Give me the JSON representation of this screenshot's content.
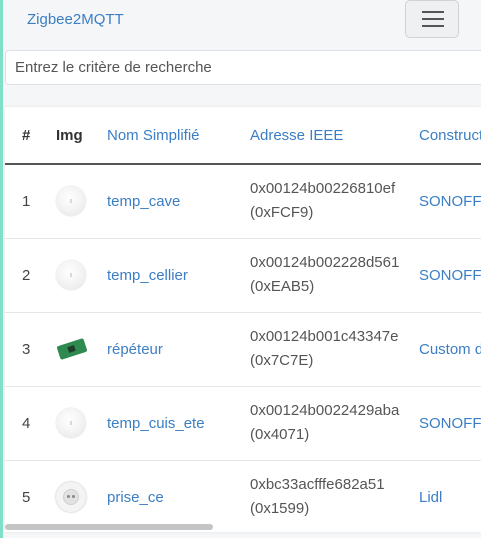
{
  "navbar": {
    "brand": "Zigbee2MQTT",
    "toggler_icon": "hamburger-menu-icon"
  },
  "search": {
    "placeholder": "Entrez le critère de recherche",
    "value": ""
  },
  "table": {
    "headers": {
      "num": "#",
      "img": "Img",
      "name": "Nom Simplifié",
      "ieee": "Adresse IEEE",
      "maker": "Constructeur"
    },
    "rows": [
      {
        "num": "1",
        "image": "round-sensor-icon",
        "name": "temp_cave",
        "ieee": "0x00124b00226810ef",
        "nwk": "(0xFCF9)",
        "maker": "SONOFF"
      },
      {
        "num": "2",
        "image": "round-sensor-icon",
        "name": "temp_cellier",
        "ieee": "0x00124b002228d561",
        "nwk": "(0xEAB5)",
        "maker": "SONOFF"
      },
      {
        "num": "3",
        "image": "circuit-board-icon",
        "name": "répéteur",
        "ieee": "0x00124b001c43347e",
        "nwk": "(0x7C7E)",
        "maker": "Custom devices (DiY)"
      },
      {
        "num": "4",
        "image": "round-sensor-icon",
        "name": "temp_cuis_ete",
        "ieee": "0x00124b0022429aba",
        "nwk": "(0x4071)",
        "maker": "SONOFF"
      },
      {
        "num": "5",
        "image": "smart-plug-icon",
        "name": "prise_ce",
        "ieee": "0xbc33acfffe682a51",
        "nwk": "(0x1599)",
        "maker": "Lidl"
      }
    ]
  },
  "colors": {
    "link": "#3b7ec4",
    "accent": "#7ee0c6"
  }
}
